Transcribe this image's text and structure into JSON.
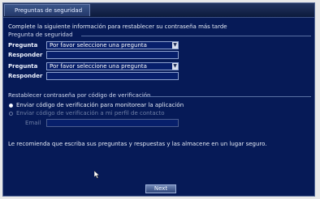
{
  "window": {
    "title": "Preguntas de seguridad"
  },
  "intro": "Complete la siguiente información para restablecer su contraseña más tarde",
  "security_questions": {
    "header": "Pregunta de seguridad",
    "rows": [
      {
        "question_label": "Pregunta",
        "question_value": "Por favor seleccione una pregunta",
        "answer_label": "Responder",
        "answer_value": ""
      },
      {
        "question_label": "Pregunta",
        "question_value": "Por favor seleccione una pregunta",
        "answer_label": "Responder",
        "answer_value": ""
      }
    ]
  },
  "verification": {
    "header": "Restablecer contraseña por código de verificación",
    "option_app": "Enviar código de verificación para monitorear la aplicación",
    "option_contact": "Enviar código de verificación a mi perfil de contacto",
    "email_label": "Email",
    "email_value": "",
    "selected": "option_app"
  },
  "recommendation": "Le recomienda que escriba sus preguntas y respuestas y las almacene en un lugar seguro.",
  "buttons": {
    "next": "Next"
  },
  "colors": {
    "background": "#061a57",
    "border": "#8da1cf",
    "accent": "#3b5589"
  }
}
